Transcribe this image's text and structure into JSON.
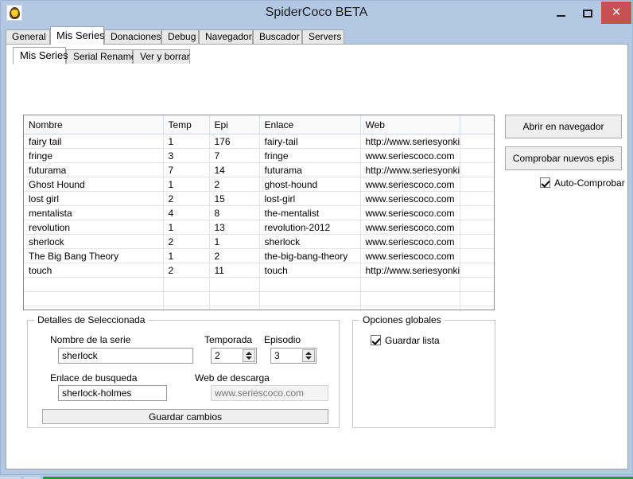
{
  "window": {
    "title": "SpiderCoco BETA",
    "icon": "spider-app-icon",
    "controls": {
      "minimize": "–",
      "maximize": "□",
      "close": "✕"
    },
    "titlebar_color": "#b3c9e3",
    "close_color": "#c75050"
  },
  "tabs": [
    {
      "label": "General",
      "active": false
    },
    {
      "label": "Mis Series",
      "active": true
    },
    {
      "label": "Donaciones",
      "active": false
    },
    {
      "label": "Debug",
      "active": false
    },
    {
      "label": "Navegador",
      "active": false
    },
    {
      "label": "Buscador",
      "active": false
    },
    {
      "label": "Servers",
      "active": false
    }
  ],
  "inner_tabs": [
    {
      "label": "Mis Series",
      "active": true
    },
    {
      "label": "Serial Renamer",
      "active": false
    },
    {
      "label": "Ver y borrar",
      "active": false
    }
  ],
  "grid": {
    "columns": [
      "Nombre",
      "Temp",
      "Epi",
      "Enlace",
      "Web",
      ""
    ],
    "rows": [
      {
        "nombre": "fairy tail",
        "temp": "1",
        "epi": "176",
        "enlace": "fairy-tail",
        "web": "http://www.seriesyonkis.com",
        "extra": ""
      },
      {
        "nombre": "fringe",
        "temp": "3",
        "epi": "7",
        "enlace": "fringe",
        "web": "www.seriescoco.com",
        "extra": ""
      },
      {
        "nombre": "futurama",
        "temp": "7",
        "epi": "14",
        "enlace": "futurama",
        "web": "http://www.seriesyonkis.com",
        "extra": ""
      },
      {
        "nombre": "Ghost Hound",
        "temp": "1",
        "epi": "2",
        "enlace": "ghost-hound",
        "web": "www.seriescoco.com",
        "extra": ""
      },
      {
        "nombre": "lost girl",
        "temp": "2",
        "epi": "15",
        "enlace": "lost-girl",
        "web": "www.seriescoco.com",
        "extra": ""
      },
      {
        "nombre": "mentalista",
        "temp": "4",
        "epi": "8",
        "enlace": "the-mentalist",
        "web": "www.seriescoco.com",
        "extra": ""
      },
      {
        "nombre": "revolution",
        "temp": "1",
        "epi": "13",
        "enlace": "revolution-2012",
        "web": "www.seriescoco.com",
        "extra": ""
      },
      {
        "nombre": "sherlock",
        "temp": "2",
        "epi": "1",
        "enlace": "sherlock",
        "web": "www.seriescoco.com",
        "extra": ""
      },
      {
        "nombre": "The Big Bang Theory",
        "temp": "1",
        "epi": "2",
        "enlace": "the-big-bang-theory",
        "web": "www.seriescoco.com",
        "extra": ""
      },
      {
        "nombre": "touch",
        "temp": "2",
        "epi": "11",
        "enlace": "touch",
        "web": "http://www.seriesyonkis.com",
        "extra": ""
      },
      {
        "nombre": "",
        "temp": "",
        "epi": "",
        "enlace": "",
        "web": "",
        "extra": ""
      },
      {
        "nombre": "",
        "temp": "",
        "epi": "",
        "enlace": "",
        "web": "",
        "extra": ""
      },
      {
        "nombre": "",
        "temp": "",
        "epi": "",
        "enlace": "",
        "web": "",
        "extra": ""
      },
      {
        "nombre": "",
        "temp": "",
        "epi": "",
        "enlace": "",
        "web": "",
        "extra": ""
      }
    ]
  },
  "side_actions": {
    "open_browser": "Abrir en navegador",
    "check_new_episodes": "Comprobar nuevos epis",
    "auto_check_label": "Auto-Comprobar",
    "auto_check_checked": true
  },
  "details_group": {
    "title": "Detalles de Seleccionada",
    "name_label": "Nombre de la serie",
    "name_value": "sherlock",
    "season_label": "Temporada",
    "season_value": "2",
    "episode_label": "Episodio",
    "episode_value": "3",
    "search_link_label": "Enlace de busqueda",
    "search_link_value": "sherlock-holmes",
    "download_web_label": "Web de descarga",
    "download_web_placeholder": "www.seriescoco.com",
    "save_button": "Guardar cambios"
  },
  "global_options": {
    "title": "Opciones globales",
    "save_list_label": "Guardar lista",
    "save_list_checked": true
  }
}
